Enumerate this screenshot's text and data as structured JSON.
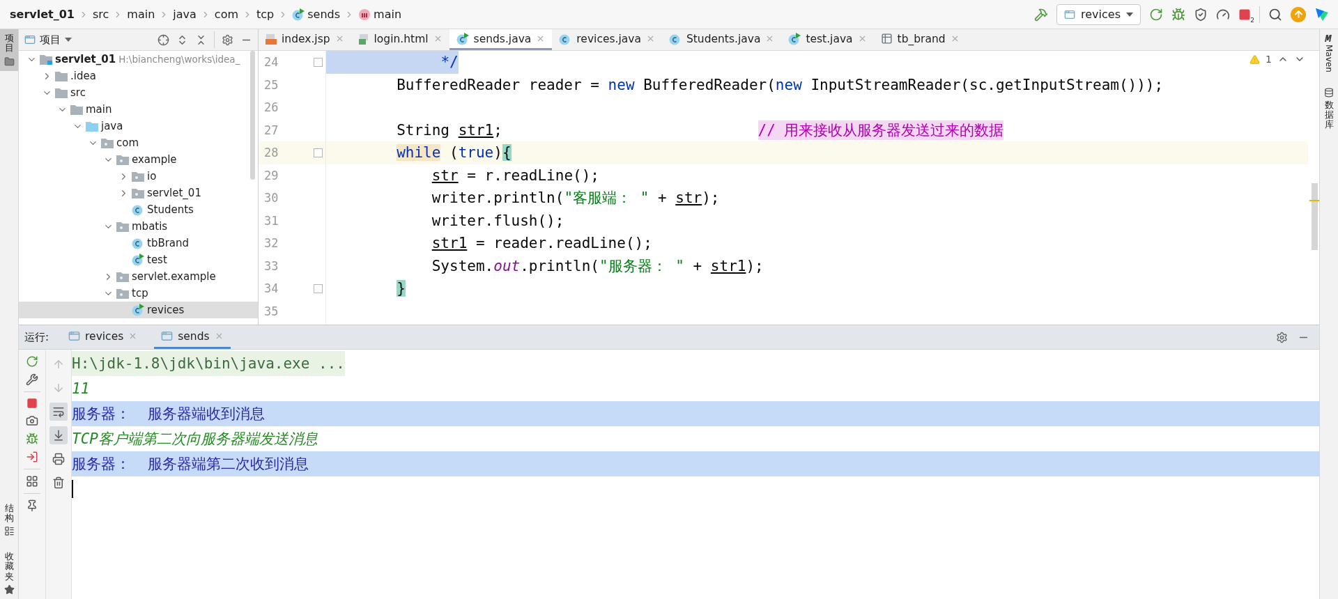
{
  "breadcrumbs": [
    {
      "label": "servlet_01",
      "kind": "module"
    },
    {
      "label": "src",
      "kind": "folder"
    },
    {
      "label": "main",
      "kind": "folder"
    },
    {
      "label": "java",
      "kind": "folder"
    },
    {
      "label": "com",
      "kind": "folder"
    },
    {
      "label": "tcp",
      "kind": "folder"
    },
    {
      "label": "sends",
      "kind": "class"
    },
    {
      "label": "main",
      "kind": "method"
    }
  ],
  "run_config": {
    "label": "revices"
  },
  "stop_count": "2",
  "left_strip": {
    "top": [
      {
        "label": "项目",
        "selected": true
      }
    ],
    "bottom": [
      {
        "label": "结构",
        "selected": false,
        "kind": "structure"
      },
      {
        "label": "收藏夹",
        "selected": false,
        "kind": "favorites"
      }
    ]
  },
  "project_panel": {
    "title": "项目",
    "tree": [
      {
        "label": "servlet_01",
        "kind": "module",
        "path": "H:\\biancheng\\works\\idea_",
        "expanded": true,
        "selected": false,
        "children": [
          {
            "label": ".idea",
            "kind": "folder",
            "expanded": false,
            "selected": false
          },
          {
            "label": "src",
            "kind": "folder",
            "expanded": true,
            "selected": false,
            "children": [
              {
                "label": "main",
                "kind": "folder",
                "expanded": true,
                "selected": false,
                "children": [
                  {
                    "label": "java",
                    "kind": "source",
                    "expanded": true,
                    "selected": false,
                    "children": [
                      {
                        "label": "com",
                        "kind": "package",
                        "expanded": true,
                        "selected": false,
                        "children": [
                          {
                            "label": "example",
                            "kind": "package",
                            "expanded": true,
                            "selected": false,
                            "children": [
                              {
                                "label": "io",
                                "kind": "package",
                                "expanded": false,
                                "selected": false
                              },
                              {
                                "label": "servlet_01",
                                "kind": "package",
                                "expanded": false,
                                "selected": false
                              },
                              {
                                "label": "Students",
                                "kind": "class",
                                "selected": false
                              }
                            ]
                          },
                          {
                            "label": "mbatis",
                            "kind": "package",
                            "expanded": true,
                            "selected": false,
                            "children": [
                              {
                                "label": "tbBrand",
                                "kind": "class",
                                "selected": false
                              },
                              {
                                "label": "test",
                                "kind": "class-run",
                                "selected": false
                              }
                            ]
                          },
                          {
                            "label": "servlet.example",
                            "kind": "package",
                            "expanded": false,
                            "selected": false
                          },
                          {
                            "label": "tcp",
                            "kind": "package",
                            "expanded": true,
                            "selected": false,
                            "children": [
                              {
                                "label": "revices",
                                "kind": "class-run",
                                "selected": true
                              }
                            ]
                          }
                        ]
                      }
                    ]
                  }
                ]
              }
            ]
          }
        ]
      }
    ]
  },
  "editor_tabs": [
    {
      "label": "index.jsp",
      "kind": "jsp",
      "selected": false
    },
    {
      "label": "login.html",
      "kind": "html",
      "selected": false
    },
    {
      "label": "sends.java",
      "kind": "class-run",
      "selected": true
    },
    {
      "label": "revices.java",
      "kind": "class",
      "selected": false
    },
    {
      "label": "Students.java",
      "kind": "class",
      "selected": false
    },
    {
      "label": "test.java",
      "kind": "class-run",
      "selected": false
    },
    {
      "label": "tb_brand",
      "kind": "table",
      "selected": false
    }
  ],
  "warnings": "1",
  "code_lines": [
    {
      "number": "24",
      "selected": true,
      "current": false,
      "fold": true,
      "tokens": [
        {
          "text": "             */",
          "kind": "doc"
        }
      ]
    },
    {
      "number": "25",
      "selected": false,
      "current": false,
      "fold": false,
      "tokens": [
        {
          "text": "        BufferedReader reader = ",
          "kind": "plain"
        },
        {
          "text": "new",
          "kind": "keyword"
        },
        {
          "text": " BufferedReader(",
          "kind": "plain"
        },
        {
          "text": "new",
          "kind": "keyword"
        },
        {
          "text": " InputStreamReader(sc.getInputStream()));",
          "kind": "plain"
        }
      ]
    },
    {
      "number": "26",
      "selected": false,
      "current": false,
      "fold": false
    },
    {
      "number": "27",
      "selected": false,
      "current": false,
      "fold": false,
      "tokens": [
        {
          "text": "        String ",
          "kind": "plain"
        },
        {
          "text": "str1",
          "kind": "var"
        },
        {
          "text": ";                             ",
          "kind": "plain"
        },
        {
          "text": "// 用来接收从服务器发送过来的数据",
          "kind": "comment"
        }
      ]
    },
    {
      "number": "28",
      "selected": false,
      "current": true,
      "fold": true,
      "tokens": [
        {
          "text": "        while",
          "kind": "keyword",
          "marked": true
        },
        {
          "text": " (",
          "kind": "plain"
        },
        {
          "text": "true",
          "kind": "keyword"
        },
        {
          "text": ")",
          "kind": "plain"
        },
        {
          "text": "{",
          "kind": "brace",
          "marked": true
        }
      ]
    },
    {
      "number": "29",
      "selected": false,
      "current": false,
      "fold": false,
      "tokens": [
        {
          "text": "            str",
          "kind": "var"
        },
        {
          "text": " = r.readLine();",
          "kind": "plain"
        }
      ]
    },
    {
      "number": "30",
      "selected": false,
      "current": false,
      "fold": false,
      "tokens": [
        {
          "text": "            writer.println(",
          "kind": "plain"
        },
        {
          "text": "\"客服端： \"",
          "kind": "string"
        },
        {
          "text": " + ",
          "kind": "plain"
        },
        {
          "text": "str",
          "kind": "var"
        },
        {
          "text": ");",
          "kind": "plain"
        }
      ]
    },
    {
      "number": "31",
      "selected": false,
      "current": false,
      "fold": false,
      "tokens": [
        {
          "text": "            writer.flush();",
          "kind": "plain"
        }
      ]
    },
    {
      "number": "32",
      "selected": false,
      "current": false,
      "fold": false,
      "tokens": [
        {
          "text": "            str1",
          "kind": "var"
        },
        {
          "text": " = reader.readLine();",
          "kind": "plain"
        }
      ]
    },
    {
      "number": "33",
      "selected": false,
      "current": false,
      "fold": false,
      "tokens": [
        {
          "text": "            System.",
          "kind": "plain"
        },
        {
          "text": "out",
          "kind": "field"
        },
        {
          "text": ".println(",
          "kind": "plain"
        },
        {
          "text": "\"服务器： \"",
          "kind": "string"
        },
        {
          "text": " + ",
          "kind": "plain"
        },
        {
          "text": "str1",
          "kind": "var"
        },
        {
          "text": ");",
          "kind": "plain"
        }
      ]
    },
    {
      "number": "34",
      "selected": false,
      "current": false,
      "fold": true,
      "tokens": [
        {
          "text": "        }",
          "kind": "brace",
          "marked": true
        }
      ]
    },
    {
      "number": "35",
      "selected": false,
      "current": false,
      "fold": false
    }
  ],
  "right_strip": [
    {
      "label": "Maven",
      "kind": "maven"
    },
    {
      "label": "数据库",
      "kind": "database"
    }
  ],
  "run_panel": {
    "label": "运行:",
    "tabs": [
      {
        "label": "revices",
        "selected": false
      },
      {
        "label": "sends",
        "selected": true
      }
    ],
    "side_tools": [
      {
        "kind": "up",
        "disabled": true,
        "on": false
      },
      {
        "kind": "down",
        "disabled": true,
        "on": false
      },
      {
        "kind": "wrap",
        "disabled": false,
        "on": true
      },
      {
        "kind": "scroll-end",
        "disabled": false,
        "on": true
      },
      {
        "kind": "print",
        "disabled": false,
        "on": false
      },
      {
        "kind": "trash",
        "disabled": false,
        "on": false
      }
    ],
    "console": [
      {
        "kind": "command",
        "text": "H:\\jdk-1.8\\jdk\\bin\\java.exe ..."
      },
      {
        "kind": "input",
        "text": "11"
      },
      {
        "kind": "output",
        "text": "服务器：  服务器端收到消息"
      },
      {
        "kind": "input",
        "text": "TCP客户端第二次向服务器端发送消息"
      },
      {
        "kind": "output",
        "text": "服务器：  服务器端第二次收到消息"
      }
    ]
  }
}
